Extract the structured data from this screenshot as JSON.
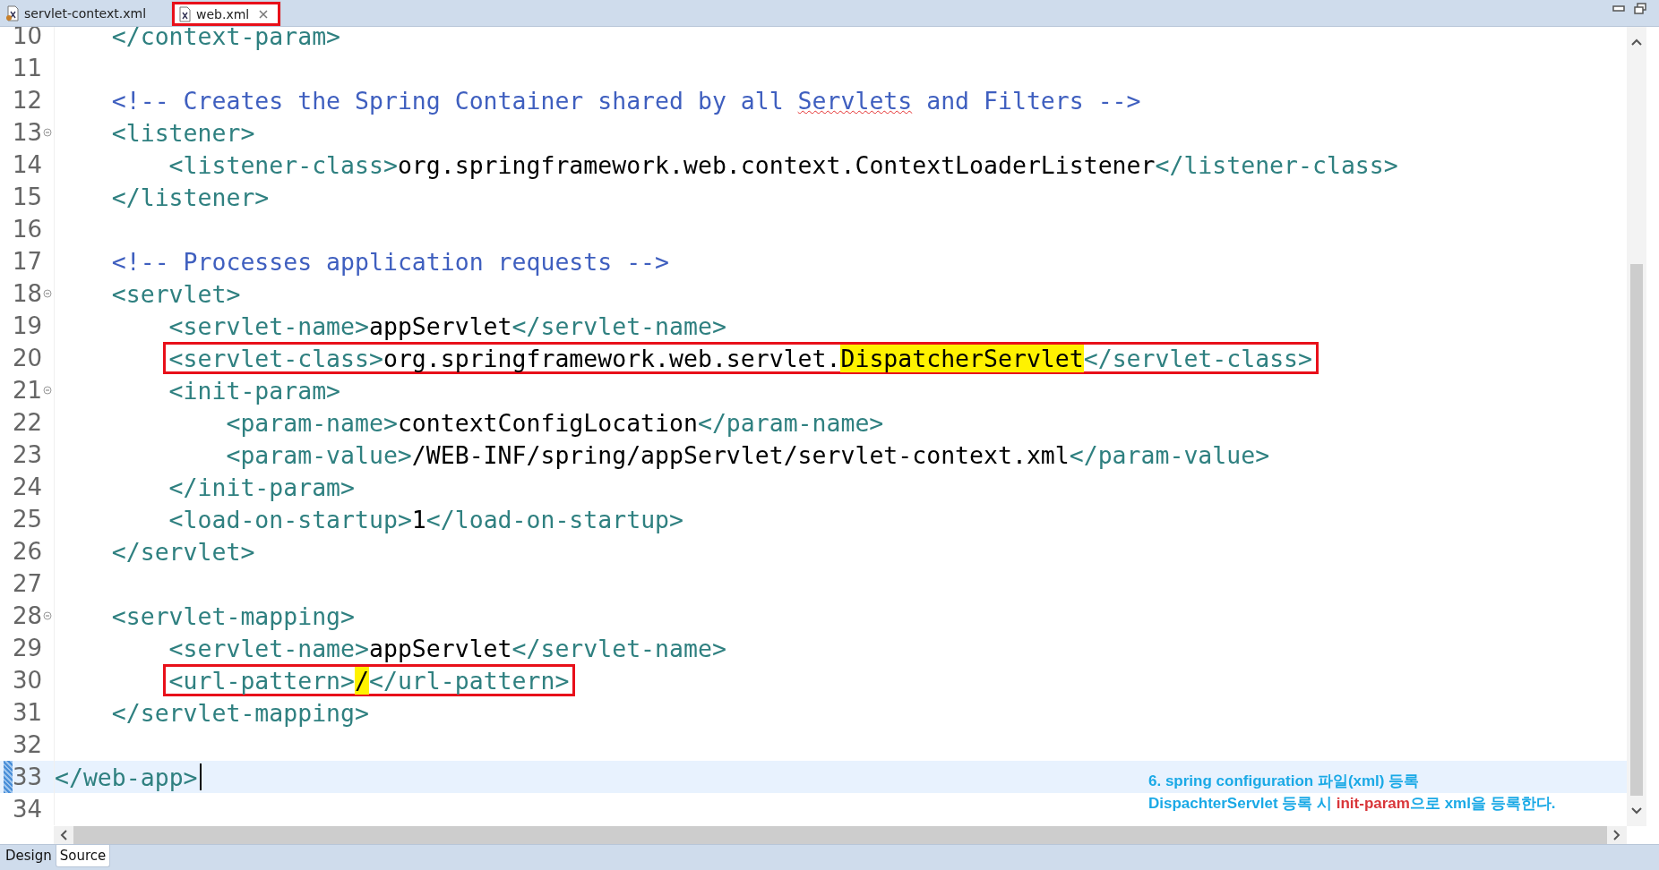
{
  "tabs": [
    {
      "label": "servlet-context.xml",
      "selected": false,
      "closable": false,
      "framed": false
    },
    {
      "label": "web.xml",
      "selected": true,
      "closable": true,
      "framed": true
    }
  ],
  "editor": {
    "lines": [
      {
        "number": "10",
        "fold": false,
        "current": false,
        "caret": false,
        "boxed": false,
        "tokens": [
          {
            "kind": "tag",
            "text": "</context-param>"
          }
        ]
      },
      {
        "number": "11",
        "fold": false,
        "current": false,
        "caret": false,
        "boxed": false
      },
      {
        "number": "12",
        "fold": false,
        "current": false,
        "caret": false,
        "boxed": false,
        "tokens": [
          {
            "kind": "comment",
            "text": "<!-- Creates the Spring Container shared by all "
          },
          {
            "kind": "misspelled",
            "text": "Servlets"
          },
          {
            "kind": "comment",
            "text": " and Filters -->"
          }
        ]
      },
      {
        "number": "13",
        "fold": true,
        "current": false,
        "caret": false,
        "boxed": false,
        "tokens": [
          {
            "kind": "tag",
            "text": "<listener>"
          }
        ],
        "children": [
          {
            "number": "14",
            "fold": false,
            "current": false,
            "caret": false,
            "boxed": false,
            "tokens": [
              {
                "kind": "tag",
                "text": "<listener-class>"
              },
              {
                "kind": "text",
                "text": "org.springframework.web.context.ContextLoaderListener"
              },
              {
                "kind": "tag",
                "text": "</listener-class>"
              }
            ]
          }
        ]
      },
      {
        "number": "15",
        "fold": false,
        "current": false,
        "caret": false,
        "boxed": false,
        "tokens": [
          {
            "kind": "tag",
            "text": "</listener>"
          }
        ]
      },
      {
        "number": "16",
        "fold": false,
        "current": false,
        "caret": false,
        "boxed": false
      },
      {
        "number": "17",
        "fold": false,
        "current": false,
        "caret": false,
        "boxed": false,
        "tokens": [
          {
            "kind": "comment",
            "text": "<!-- Processes application requests -->"
          }
        ]
      },
      {
        "number": "18",
        "fold": true,
        "current": false,
        "caret": false,
        "boxed": false,
        "tokens": [
          {
            "kind": "tag",
            "text": "<servlet>"
          }
        ],
        "children": [
          {
            "number": "19",
            "fold": false,
            "current": false,
            "caret": false,
            "boxed": false,
            "tokens": [
              {
                "kind": "tag",
                "text": "<servlet-name>"
              },
              {
                "kind": "text",
                "text": "appServlet"
              },
              {
                "kind": "tag",
                "text": "</servlet-name>"
              }
            ]
          },
          {
            "number": "20",
            "fold": false,
            "current": false,
            "caret": false,
            "boxed": true,
            "tokens": [
              {
                "kind": "tag",
                "text": "<servlet-class>"
              },
              {
                "kind": "text",
                "text": "org.springframework.web.servlet."
              },
              {
                "kind": "highlight",
                "text": "DispatcherServlet"
              },
              {
                "kind": "tag",
                "text": "</servlet-class>"
              }
            ]
          },
          {
            "number": "21",
            "fold": true,
            "current": false,
            "caret": false,
            "boxed": false,
            "tokens": [
              {
                "kind": "tag",
                "text": "<init-param>"
              }
            ],
            "children": [
              {
                "number": "22",
                "fold": false,
                "current": false,
                "caret": false,
                "boxed": false,
                "tokens": [
                  {
                    "kind": "tag",
                    "text": "<param-name>"
                  },
                  {
                    "kind": "text",
                    "text": "contextConfigLocation"
                  },
                  {
                    "kind": "tag",
                    "text": "</param-name>"
                  }
                ]
              },
              {
                "number": "23",
                "fold": false,
                "current": false,
                "caret": false,
                "boxed": false,
                "tokens": [
                  {
                    "kind": "tag",
                    "text": "<param-value>"
                  },
                  {
                    "kind": "text",
                    "text": "/WEB-INF/spring/appServlet/servlet-context.xml"
                  },
                  {
                    "kind": "tag",
                    "text": "</param-value>"
                  }
                ]
              }
            ]
          },
          {
            "number": "24",
            "fold": false,
            "current": false,
            "caret": false,
            "boxed": false,
            "tokens": [
              {
                "kind": "tag",
                "text": "</init-param>"
              }
            ]
          },
          {
            "number": "25",
            "fold": false,
            "current": false,
            "caret": false,
            "boxed": false,
            "tokens": [
              {
                "kind": "tag",
                "text": "<load-on-startup>"
              },
              {
                "kind": "text",
                "text": "1"
              },
              {
                "kind": "tag",
                "text": "</load-on-startup>"
              }
            ]
          }
        ]
      },
      {
        "number": "26",
        "fold": false,
        "current": false,
        "caret": false,
        "boxed": false,
        "tokens": [
          {
            "kind": "tag",
            "text": "</servlet>"
          }
        ]
      },
      {
        "number": "27",
        "fold": false,
        "current": false,
        "caret": false,
        "boxed": false
      },
      {
        "number": "28",
        "fold": true,
        "current": false,
        "caret": false,
        "boxed": false,
        "tokens": [
          {
            "kind": "tag",
            "text": "<servlet-mapping>"
          }
        ],
        "children": [
          {
            "number": "29",
            "fold": false,
            "current": false,
            "caret": false,
            "boxed": false,
            "tokens": [
              {
                "kind": "tag",
                "text": "<servlet-name>"
              },
              {
                "kind": "text",
                "text": "appServlet"
              },
              {
                "kind": "tag",
                "text": "</servlet-name>"
              }
            ]
          },
          {
            "number": "30",
            "fold": false,
            "current": false,
            "caret": false,
            "boxed": true,
            "tokens": [
              {
                "kind": "tag",
                "text": "<url-pattern>"
              },
              {
                "kind": "highlight",
                "text": "/"
              },
              {
                "kind": "tag",
                "text": "</url-pattern>"
              }
            ]
          }
        ]
      },
      {
        "number": "31",
        "fold": false,
        "current": false,
        "caret": false,
        "boxed": false,
        "tokens": [
          {
            "kind": "tag",
            "text": "</servlet-mapping>"
          }
        ]
      },
      {
        "number": "32",
        "fold": false,
        "current": false,
        "caret": false,
        "boxed": false
      },
      {
        "number": "33",
        "kind": "root",
        "fold": false,
        "current": true,
        "caret": true,
        "boxed": false,
        "tokens": [
          {
            "kind": "tag",
            "text": "</web-app>"
          }
        ]
      },
      {
        "number": "34",
        "fold": false,
        "current": false,
        "caret": false,
        "boxed": false
      }
    ]
  },
  "annotation": {
    "lines": [
      [
        {
          "text": "6. spring configuration 파일(xml) 등록",
          "emphasis": false
        }
      ],
      [
        {
          "text": "DispachterServlet 등록 시 ",
          "emphasis": false
        },
        {
          "text": "init-param",
          "emphasis": true
        },
        {
          "text": "으로 xml을 등록한다.",
          "emphasis": false
        }
      ]
    ]
  },
  "bottom_tabs": [
    {
      "label": "Design",
      "selected": false
    },
    {
      "label": "Source",
      "selected": true
    }
  ]
}
